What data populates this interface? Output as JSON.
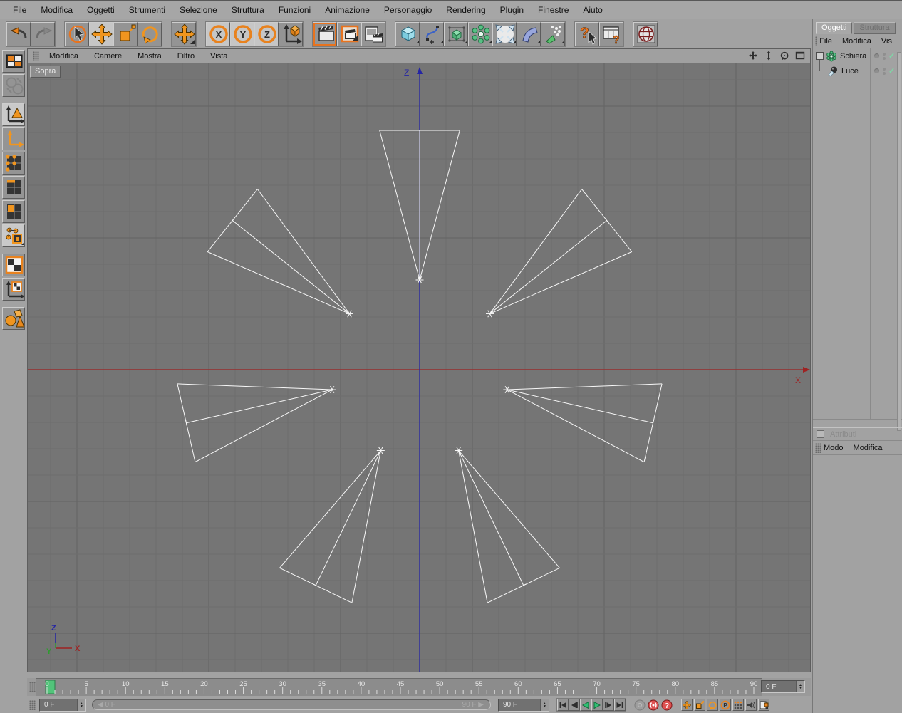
{
  "menubar": {
    "items": [
      "File",
      "Modifica",
      "Oggetti",
      "Strumenti",
      "Selezione",
      "Struttura",
      "Funzioni",
      "Animazione",
      "Personaggio",
      "Rendering",
      "Plugin",
      "Finestre",
      "Aiuto"
    ]
  },
  "toolbar": {
    "icons": [
      "undo",
      "redo",
      "live-selection",
      "move",
      "scale",
      "rotate",
      "active-tool-move",
      "lock-x",
      "lock-y",
      "lock-z",
      "coordinate-system",
      "render-view",
      "render-picture-viewer",
      "render-settings",
      "add-cube",
      "add-spline",
      "add-hypernurbs",
      "add-array",
      "add-particles",
      "add-deformer",
      "add-environment",
      "help",
      "html-help",
      "browser"
    ],
    "axis_letters": {
      "x": "X",
      "y": "Y",
      "z": "Z"
    }
  },
  "left_toolbar": {
    "icons": [
      "layout",
      "convert",
      "make-editable",
      "object-axis-mode",
      "points-mode",
      "edges-mode",
      "polygons-mode",
      "texture-tool-mode",
      "texture-mode",
      "texture-axis-mode",
      "model-mode"
    ]
  },
  "viewport": {
    "label": "Sopra",
    "menu": [
      "Modifica",
      "Camere",
      "Mostra",
      "Filtro",
      "Vista"
    ],
    "controls": [
      "pan",
      "zoom",
      "rotate",
      "maximize"
    ],
    "axis_labels": {
      "x": "X",
      "y": "Y",
      "z": "Z"
    },
    "colors": {
      "bg": "#757575",
      "grid": "#6d6d6d",
      "grid_major": "#646464",
      "x_axis": "#9e2222",
      "z_axis": "#2525a5",
      "y_axis": "#2f9b2f",
      "wire": "#f8f8f8"
    },
    "grid_size": 37,
    "center": [
      550,
      430
    ],
    "cones": {
      "count": 7,
      "start_angle_deg": 90,
      "step_deg": 51.4286,
      "radius": 126,
      "length": 210,
      "half_angle_deg": 15
    }
  },
  "object_manager": {
    "tabs": [
      {
        "label": "Oggetti"
      },
      {
        "label": "Struttura"
      }
    ],
    "menu": [
      "File",
      "Modifica",
      "Vis"
    ],
    "objects": [
      {
        "name": "Schiera"
      },
      {
        "name": "Luce"
      }
    ],
    "check_glyph": "✓"
  },
  "attributes_panel": {
    "title": "Attributi",
    "menu": [
      "Modo",
      "Modifica"
    ]
  },
  "timeline": {
    "start": 0,
    "end": 90,
    "label_step": 5,
    "current": 0,
    "marker_color": "#52c47a",
    "field": "0 F"
  },
  "transport": {
    "current_field": "0 F",
    "slider_left": "◀ 0 F",
    "slider_right": "90 F ▶",
    "end_field": "90 F",
    "buttons": [
      "goto-start",
      "previous-frame",
      "play-backward",
      "play-forward",
      "next-frame",
      "goto-end"
    ],
    "record_buttons": [
      "record-disabled",
      "record-keyframe",
      "autokey-question"
    ],
    "key_buttons": [
      "key-position",
      "key-scale",
      "key-rotation",
      "key-parameter",
      "key-pla",
      "sound",
      "keyframe-selection"
    ],
    "p_letter": "P"
  }
}
